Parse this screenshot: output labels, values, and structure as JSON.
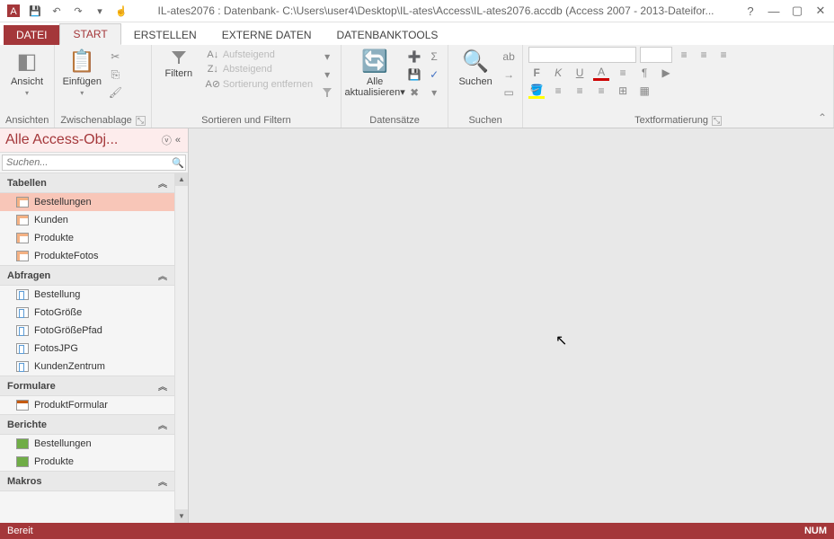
{
  "titlebar": {
    "title": "IL-ates2076 : Datenbank- C:\\Users\\user4\\Desktop\\IL-ates\\Access\\IL-ates2076.accdb (Access 2007 - 2013-Dateifor..."
  },
  "tabs": {
    "file": "DATEI",
    "start": "START",
    "erstellen": "ERSTELLEN",
    "externe": "EXTERNE DATEN",
    "dbtools": "DATENBANKTOOLS"
  },
  "ribbon": {
    "ansichten": {
      "label": "Ansichten",
      "ansicht": "Ansicht"
    },
    "zwischen": {
      "label": "Zwischenablage",
      "einfugen": "Einfügen"
    },
    "sortieren": {
      "label": "Sortieren und Filtern",
      "filtern": "Filtern",
      "auf": "Aufsteigend",
      "ab": "Absteigend",
      "entf": "Sortierung entfernen"
    },
    "datensatze": {
      "label": "Datensätze",
      "alle": "Alle",
      "aktual": "aktualisieren"
    },
    "suchen": {
      "label": "Suchen",
      "btn": "Suchen"
    },
    "textfmt": {
      "label": "Textformatierung",
      "bold": "F",
      "italic": "K",
      "under": "U"
    }
  },
  "nav": {
    "title": "Alle Access-Obj...",
    "search_placeholder": "Suchen...",
    "groups": {
      "tabellen": "Tabellen",
      "abfragen": "Abfragen",
      "formulare": "Formulare",
      "berichte": "Berichte",
      "makros": "Makros"
    },
    "tables": [
      "Bestellungen",
      "Kunden",
      "Produkte",
      "ProdukteFotos"
    ],
    "queries": [
      "Bestellung",
      "FotoGröße",
      "FotoGrößePfad",
      "FotosJPG",
      "KundenZentrum"
    ],
    "forms": [
      "ProduktFormular"
    ],
    "reports": [
      "Bestellungen",
      "Produkte"
    ]
  },
  "status": {
    "left": "Bereit",
    "right": "NUM"
  }
}
